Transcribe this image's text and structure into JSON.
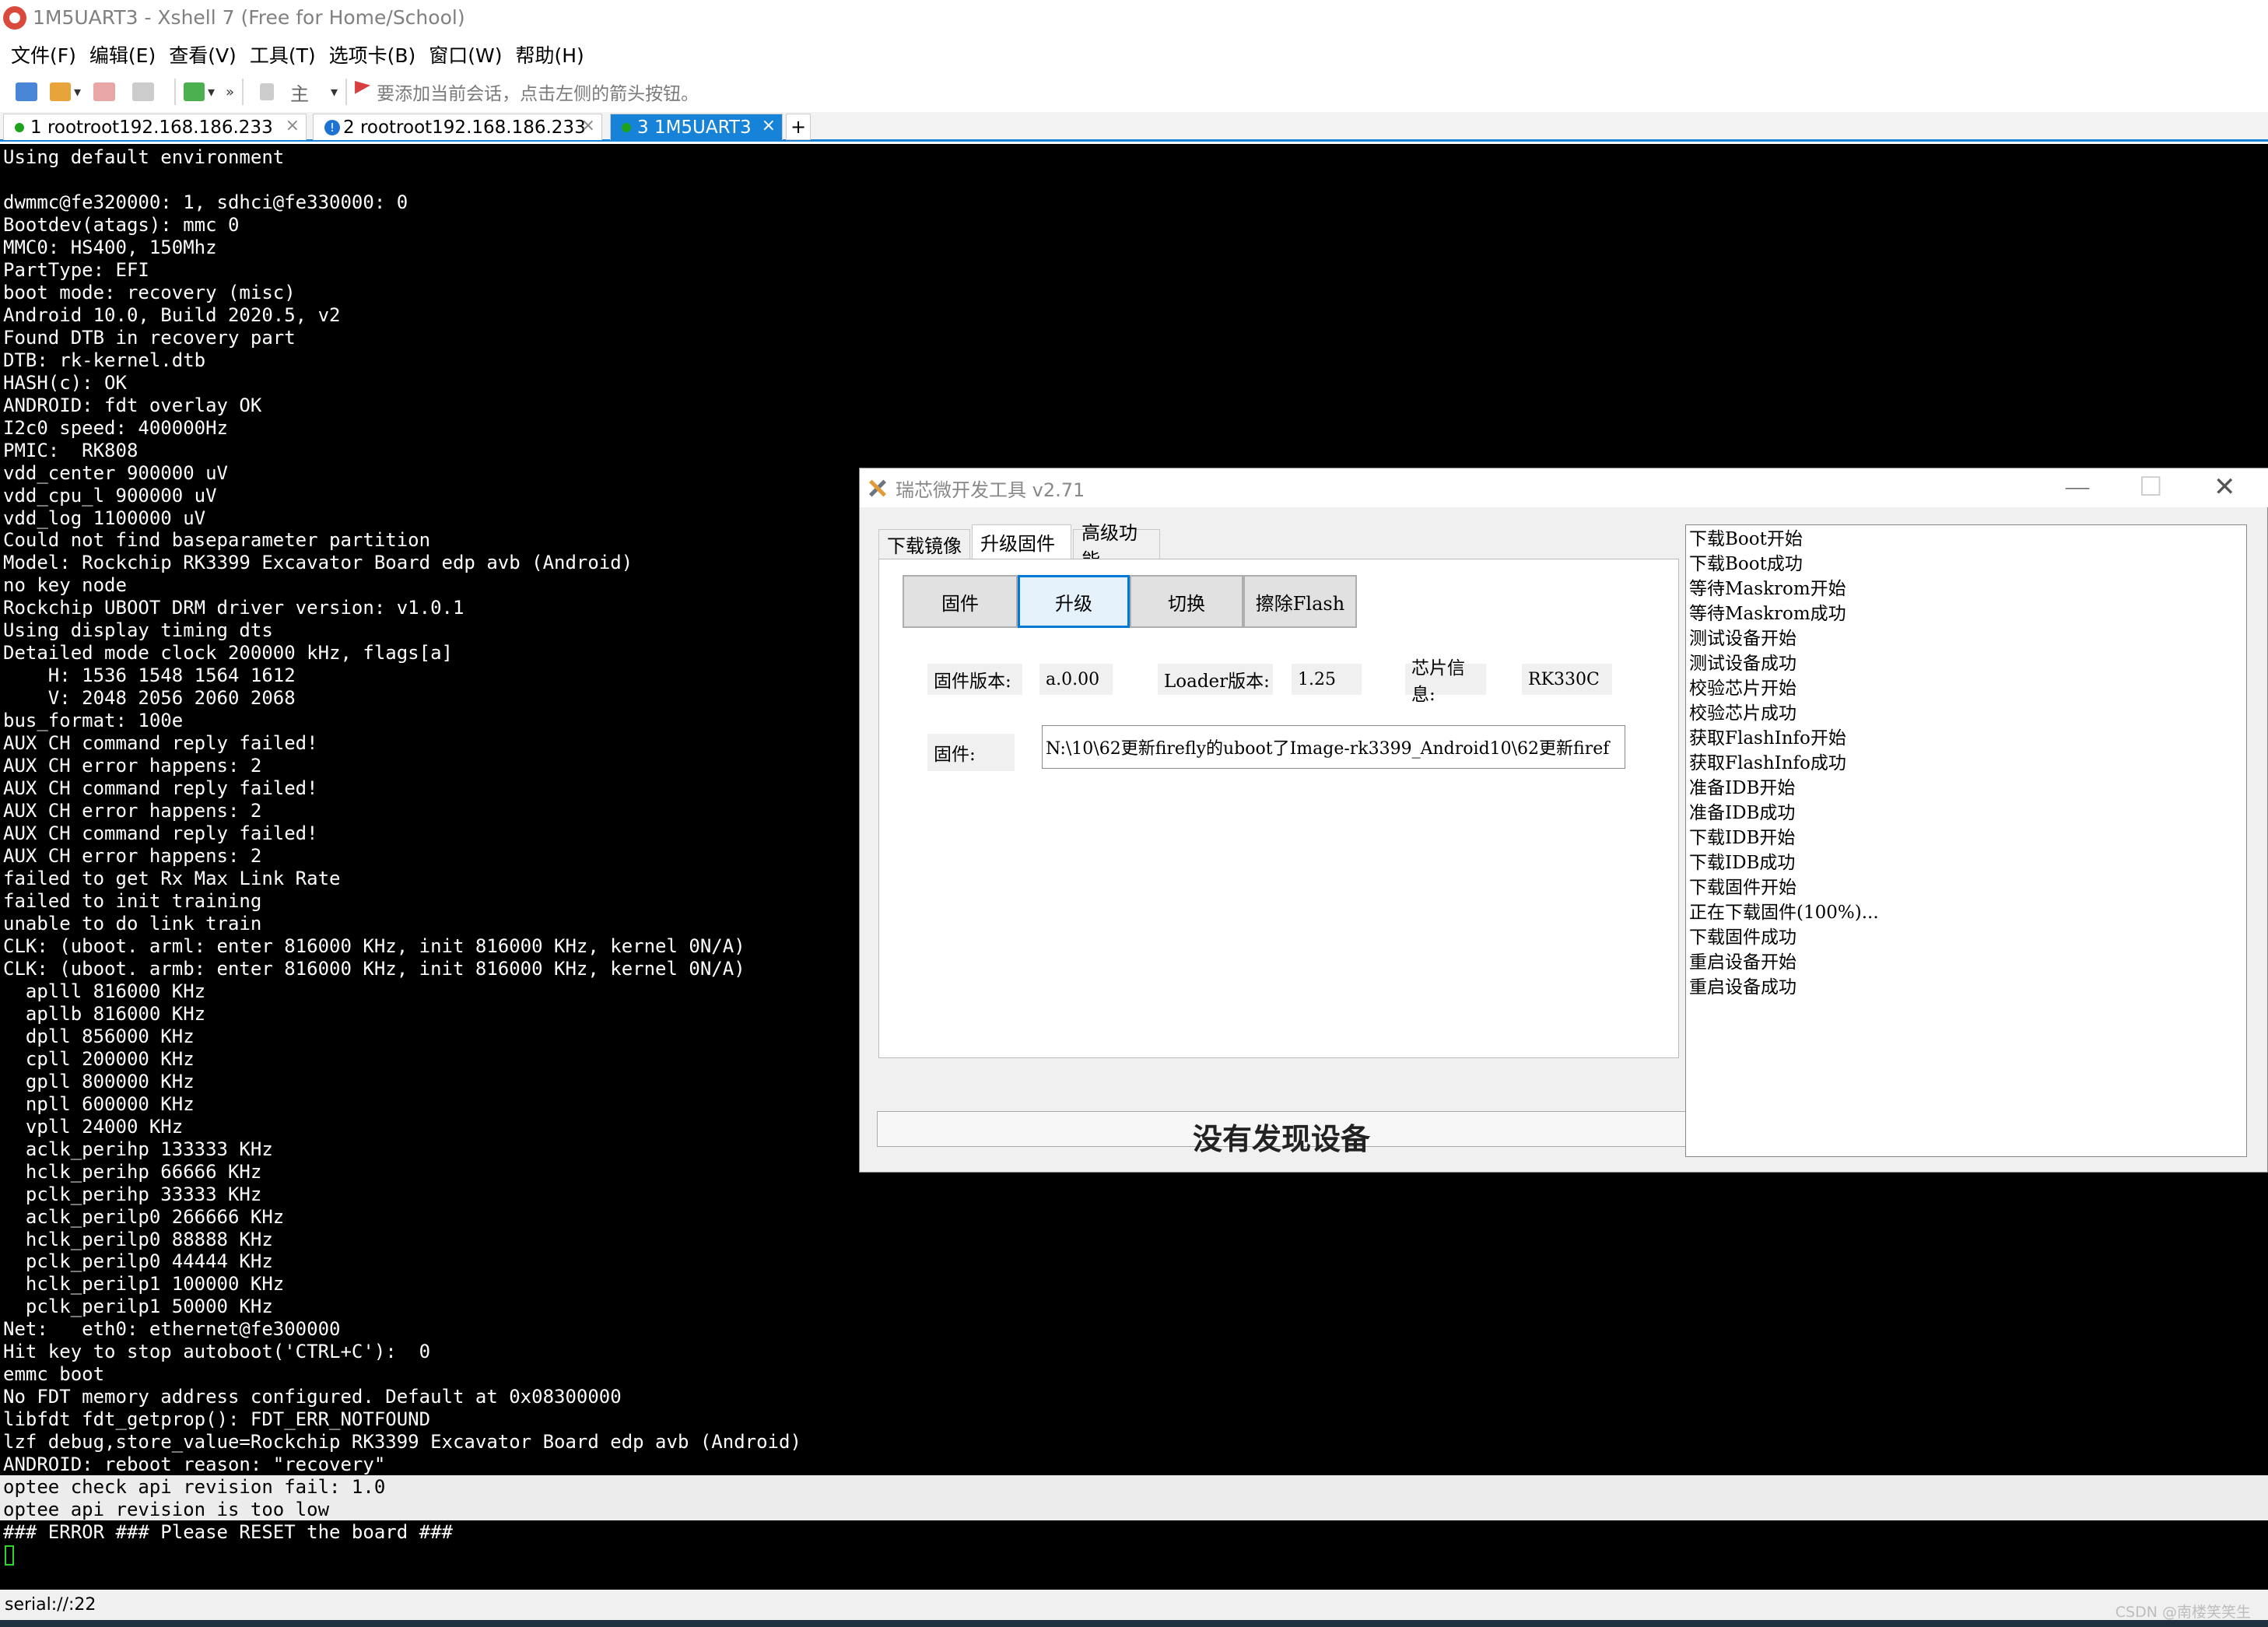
{
  "window": {
    "title": "1M5UART3 - Xshell 7 (Free for Home/School)"
  },
  "menu": [
    "文件(F)",
    "编辑(E)",
    "查看(V)",
    "工具(T)",
    "选项卡(B)",
    "窗口(W)",
    "帮助(H)"
  ],
  "toolbar": {
    "host_label": "主",
    "message": "要添加当前会话，点击左侧的箭头按钮。",
    "more": "»"
  },
  "tabs": [
    {
      "label": "1 rootroot192.168.186.233",
      "state": "connected",
      "close": "×"
    },
    {
      "label": "2 rootroot192.168.186.233",
      "state": "info",
      "close": "×"
    },
    {
      "label": "3 1M5UART3",
      "state": "active",
      "close": "×"
    }
  ],
  "tab_add": "+",
  "terminal": {
    "lines": [
      "Using default environment",
      "",
      "dwmmc@fe320000: 1, sdhci@fe330000: 0",
      "Bootdev(atags): mmc 0",
      "MMC0: HS400, 150Mhz",
      "PartType: EFI",
      "boot mode: recovery (misc)",
      "Android 10.0, Build 2020.5, v2",
      "Found DTB in recovery part",
      "DTB: rk-kernel.dtb",
      "HASH(c): OK",
      "ANDROID: fdt overlay OK",
      "I2c0 speed: 400000Hz",
      "PMIC:  RK808",
      "vdd_center 900000 uV",
      "vdd_cpu_l 900000 uV",
      "vdd_log 1100000 uV",
      "Could not find baseparameter partition",
      "Model: Rockchip RK3399 Excavator Board edp avb (Android)",
      "no key node",
      "Rockchip UBOOT DRM driver version: v1.0.1",
      "Using display timing dts",
      "Detailed mode clock 200000 kHz, flags[a]",
      "    H: 1536 1548 1564 1612",
      "    V: 2048 2056 2060 2068",
      "bus_format: 100e",
      "AUX CH command reply failed!",
      "AUX CH error happens: 2",
      "AUX CH command reply failed!",
      "AUX CH error happens: 2",
      "AUX CH command reply failed!",
      "AUX CH error happens: 2",
      "failed to get Rx Max Link Rate",
      "failed to init training",
      "unable to do link train",
      "CLK: (uboot. arml: enter 816000 KHz, init 816000 KHz, kernel 0N/A)",
      "CLK: (uboot. armb: enter 816000 KHz, init 816000 KHz, kernel 0N/A)",
      "  aplll 816000 KHz",
      "  apllb 816000 KHz",
      "  dpll 856000 KHz",
      "  cpll 200000 KHz",
      "  gpll 800000 KHz",
      "  npll 600000 KHz",
      "  vpll 24000 KHz",
      "  aclk_perihp 133333 KHz",
      "  hclk_perihp 66666 KHz",
      "  pclk_perihp 33333 KHz",
      "  aclk_perilp0 266666 KHz",
      "  hclk_perilp0 88888 KHz",
      "  pclk_perilp0 44444 KHz",
      "  hclk_perilp1 100000 KHz",
      "  pclk_perilp1 50000 KHz",
      "Net:   eth0: ethernet@fe300000",
      "Hit key to stop autoboot('CTRL+C'):  0",
      "emmc boot",
      "No FDT memory address configured. Default at 0x08300000",
      "libfdt fdt_getprop(): FDT_ERR_NOTFOUND",
      "lzf debug,store_value=Rockchip RK3399 Excavator Board edp avb (Android)",
      "ANDROID: reboot reason: \"recovery\"",
      "optee check api revision fail: 1.0",
      "optee api revision is too low",
      "### ERROR ### Please RESET the board ###"
    ],
    "highlighted_lines": [
      59,
      60
    ]
  },
  "status": {
    "text": "serial://:22"
  },
  "watermark": "CSDN @南楼笑笑生",
  "dialog": {
    "title": "瑞芯微开发工具 v2.71",
    "controls": {
      "minimize": "—",
      "maximize": "☐",
      "close": "✕"
    },
    "tabs": [
      "下载镜像",
      "升级固件",
      "高级功能"
    ],
    "selected_tab": "升级固件",
    "buttons": [
      "固件",
      "升级",
      "切换",
      "擦除Flash"
    ],
    "focused_button": "升级",
    "firmware_version_label": "固件版本:",
    "firmware_version": "a.0.00",
    "loader_version_label": "Loader版本:",
    "loader_version": "1.25",
    "chip_info_label": "芯片信息:",
    "chip_info": "RK330C",
    "firmware_label": "固件:",
    "firmware_path": "N:\\10\\62更新firefly的uboot了Image-rk3399_Android10\\62更新firef",
    "status_message": "没有发现设备",
    "log": [
      "下载Boot开始",
      "下载Boot成功",
      "等待Maskrom开始",
      "等待Maskrom成功",
      "测试设备开始",
      "测试设备成功",
      "校验芯片开始",
      "校验芯片成功",
      "获取FlashInfo开始",
      "获取FlashInfo成功",
      "准备IDB开始",
      "准备IDB成功",
      "下载IDB开始",
      "下载IDB成功",
      "下载固件开始",
      "正在下载固件(100%)...",
      "下载固件成功",
      "重启设备开始",
      "重启设备成功"
    ]
  },
  "colors": {
    "accent": "#1683d8",
    "terminal_bg": "#000000",
    "terminal_fg": "#ffffff",
    "highlight_bg": "#ececec",
    "cursor": "#2ed32e"
  }
}
